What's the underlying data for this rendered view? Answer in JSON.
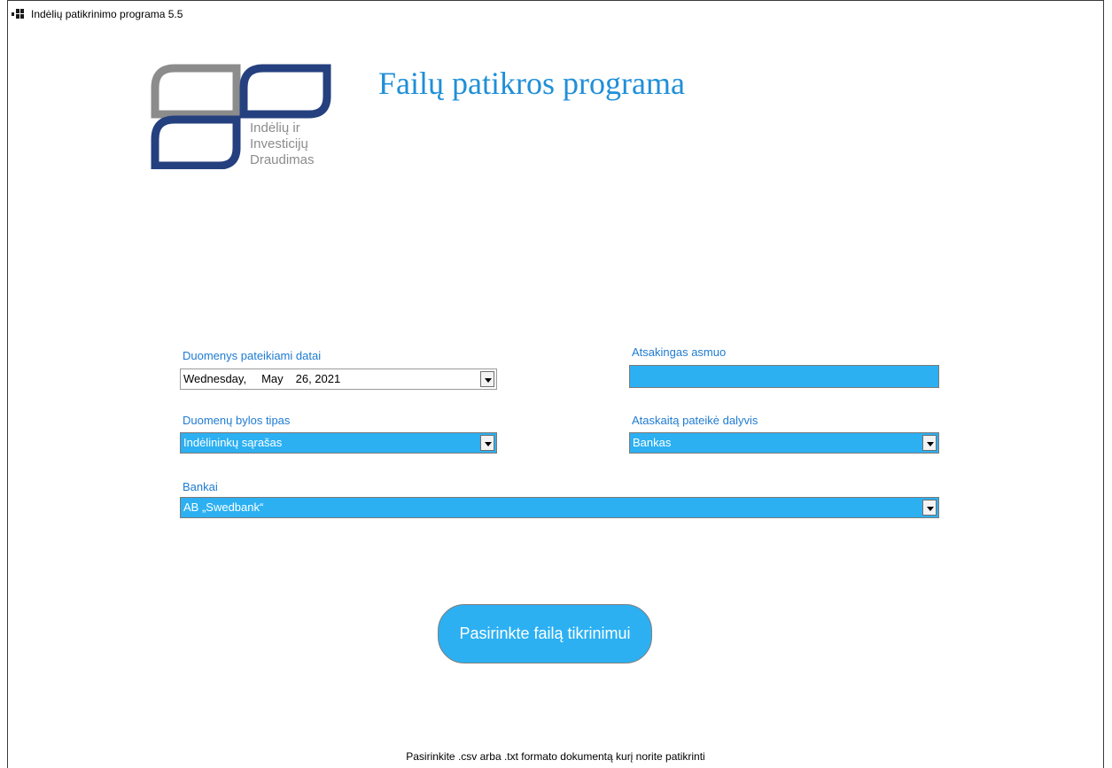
{
  "window": {
    "title": "Indėlių patikrinimo programa 5.5"
  },
  "logo": {
    "lines": [
      "Indėlių ir",
      "Investicijų",
      "Draudimas"
    ]
  },
  "heading": "Failų patikros programa",
  "date_field": {
    "label": "Duomenys pateikiami datai",
    "weekday": "Wednesday,",
    "month": "May",
    "day_year": "26, 2021"
  },
  "responsible": {
    "label": "Atsakingas asmuo",
    "value": ""
  },
  "file_type": {
    "label": "Duomenų bylos tipas",
    "selected": "Indėlininkų sąrašas"
  },
  "participant": {
    "label": "Ataskaitą pateikė dalyvis",
    "selected": "Bankas"
  },
  "banks": {
    "label": "Bankai",
    "selected": "AB „Swedbank“"
  },
  "choose_button": "Pasirinkte failą tikrinimui",
  "footer": "Pasirinkite .csv arba .txt formato dokumentą kurį norite patikrinti",
  "colors": {
    "accent": "#2cb0f2",
    "label": "#1e7bd1",
    "heading": "#1f8fd8",
    "logo_gray": "#8c8c8c",
    "logo_blue": "#25407f"
  }
}
